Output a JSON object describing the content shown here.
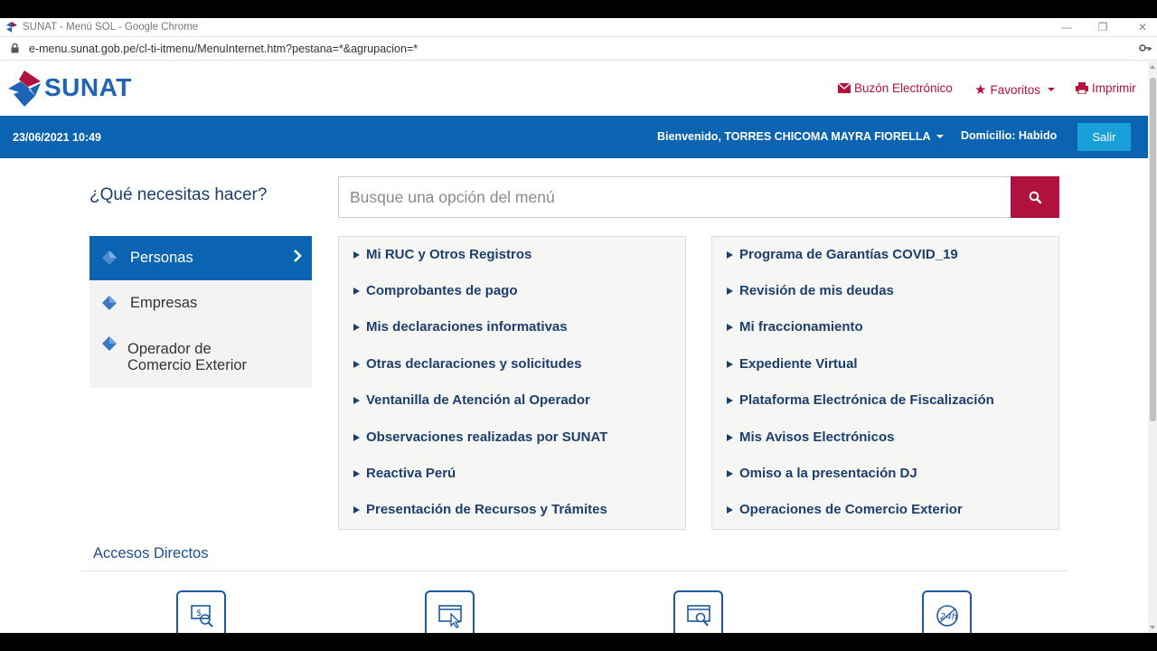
{
  "browser": {
    "window_title": "SUNAT - Menú SOL - Google Chrome",
    "url": "e-menu.sunat.gob.pe/cl-ti-itmenu/MenuInternet.htm?pestana=*&agrupacion=*"
  },
  "header": {
    "logo_text": "SUNAT",
    "links": {
      "buzon": "Buzón Electrónico",
      "favoritos": "Favoritos",
      "imprimir": "Imprimir"
    }
  },
  "band": {
    "datetime": "23/06/2021 10:49",
    "welcome": "Bienvenido, TORRES CHICOMA MAYRA FIORELLA",
    "domicilio": "Domicilio: Habido",
    "salir": "Salir"
  },
  "question": "¿Qué necesitas hacer?",
  "search": {
    "placeholder": "Busque una opción del menú"
  },
  "leftnav": {
    "items": [
      {
        "label": "Personas",
        "active": true
      },
      {
        "label": "Empresas",
        "active": false
      },
      {
        "label": "Operador de Comercio Exterior",
        "line1": "Operador de",
        "line2": "Comercio Exterior",
        "active": false
      }
    ]
  },
  "panel_left": {
    "items": [
      "Mi RUC y Otros Registros",
      "Comprobantes de pago",
      "Mis declaraciones informativas",
      "Otras declaraciones y solicitudes",
      "Ventanilla de Atención al Operador",
      "Observaciones realizadas por SUNAT",
      "Reactiva Perú",
      "Presentación de Recursos y Trámites"
    ]
  },
  "panel_right": {
    "items": [
      "Programa de Garantías COVID_19",
      "Revisión de mis deudas",
      "Mi fraccionamiento",
      "Expediente Virtual",
      "Plataforma Electrónica de Fiscalización",
      "Mis Avisos Electrónicos",
      "Omiso a la presentación DJ",
      "Operaciones de Comercio Exterior"
    ]
  },
  "accesos": {
    "title": "Accesos Directos",
    "icons": [
      "payment-icon",
      "browser-click-icon",
      "browser-search-icon",
      "24h-icon"
    ]
  },
  "colors": {
    "brand_blue": "#0b64b1",
    "brand_red": "#b0113d",
    "link_red": "#b5113c",
    "navy_text": "#1c3f6e",
    "salir_button": "#1aa0d8"
  }
}
